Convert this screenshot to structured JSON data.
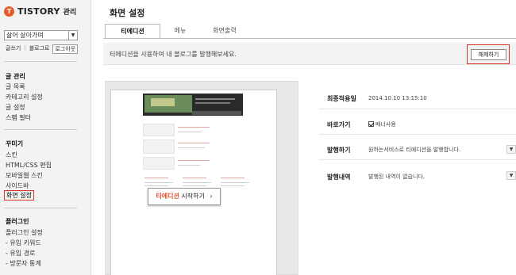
{
  "sidebar": {
    "logo_icon": "T",
    "logo_text": "TISTORY",
    "logo_sub": "관리",
    "blog_select_value": "삶어 살아가며",
    "links": [
      "글쓰기",
      "블로그로"
    ],
    "logout": "로그아웃",
    "sections": [
      {
        "title": "글 관리",
        "items": [
          "글 목록",
          "카테고리 설정",
          "글 설정",
          "스팸 필터"
        ]
      },
      {
        "title": "꾸미기",
        "items": [
          "스킨",
          "HTML/CSS 편집",
          "모바일웹 스킨",
          "사이드바",
          "화면 설정"
        ]
      },
      {
        "title": "플러그인",
        "items": [
          "플러그인 설정",
          "- 유입 키워드",
          "- 유입 경로",
          "- 방문자 통계"
        ]
      }
    ]
  },
  "main": {
    "page_title": "화면 설정",
    "tabs": [
      {
        "label": "티에디션"
      },
      {
        "label": "메뉴"
      },
      {
        "label": "화면출력"
      }
    ],
    "notice": "티에디션을 사용하여 내 블로그를 발행해보세요.",
    "release_button": "해제하기",
    "start_button_highlight": "티에디션",
    "start_button_rest": " 시작하기",
    "start_button_arrow": "›",
    "info": {
      "last_applied_label": "최종적용일",
      "last_applied_value": "2014.10.10 13:15:10",
      "shortcut_label": "바로가기",
      "shortcut_value": "배너사용",
      "publish_label": "발행하기",
      "publish_value": "원하는서비스로 티에디션을 발행합니다.",
      "history_label": "발행내역",
      "history_value": "발행된 내역이 없습니다."
    }
  },
  "colors": {
    "accent_red": "#d9342b",
    "logo_orange": "#e85a2a"
  }
}
